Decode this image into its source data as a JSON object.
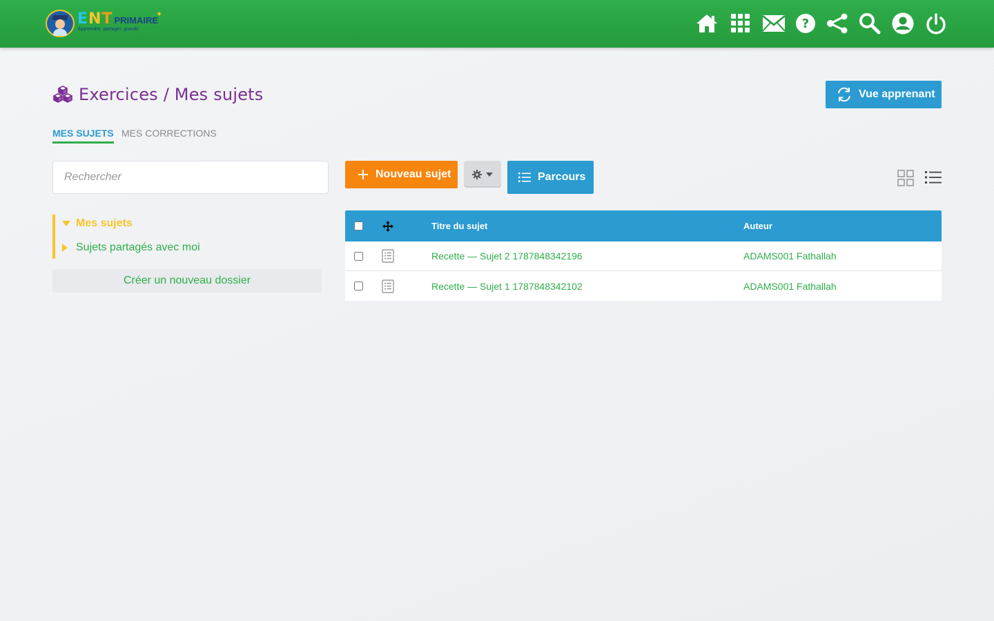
{
  "header": {
    "logo": {
      "ent": "ENT",
      "primaire": "PRIMAIRE",
      "tagline": "Apprendre, partager, grandir."
    },
    "icons": [
      "home-icon",
      "apps-grid-icon",
      "mail-icon",
      "help-icon",
      "share-icon",
      "search-icon",
      "user-icon",
      "power-icon"
    ]
  },
  "page": {
    "title": "Exercices / Mes sujets",
    "vue_apprenant_label": "Vue apprenant"
  },
  "tabs": [
    {
      "label": "MES SUJETS",
      "active": true
    },
    {
      "label": "MES CORRECTIONS",
      "active": false
    }
  ],
  "sidebar": {
    "search_placeholder": "Rechercher",
    "tree": [
      {
        "label": "Mes sujets",
        "expanded": true
      },
      {
        "label": "Sujets partagés avec moi",
        "expanded": false
      }
    ],
    "new_folder_label": "Créer un nouveau dossier"
  },
  "toolbar": {
    "new_label": "Nouveau sujet",
    "parcours_label": "Parcours"
  },
  "table": {
    "headers": {
      "title": "Titre du sujet",
      "author": "Auteur"
    },
    "rows": [
      {
        "title": "Recette — Sujet 2 1787848342196",
        "author": "ADAMS001 Fathallah"
      },
      {
        "title": "Recette — Sujet 1 1787848342102",
        "author": "ADAMS001 Fathallah"
      }
    ]
  },
  "colors": {
    "header_green": "#2fae4a",
    "accent_blue": "#2b9bd1",
    "orange": "#f7860f",
    "purple": "#7a2e91",
    "yellow": "#f7c52b"
  }
}
